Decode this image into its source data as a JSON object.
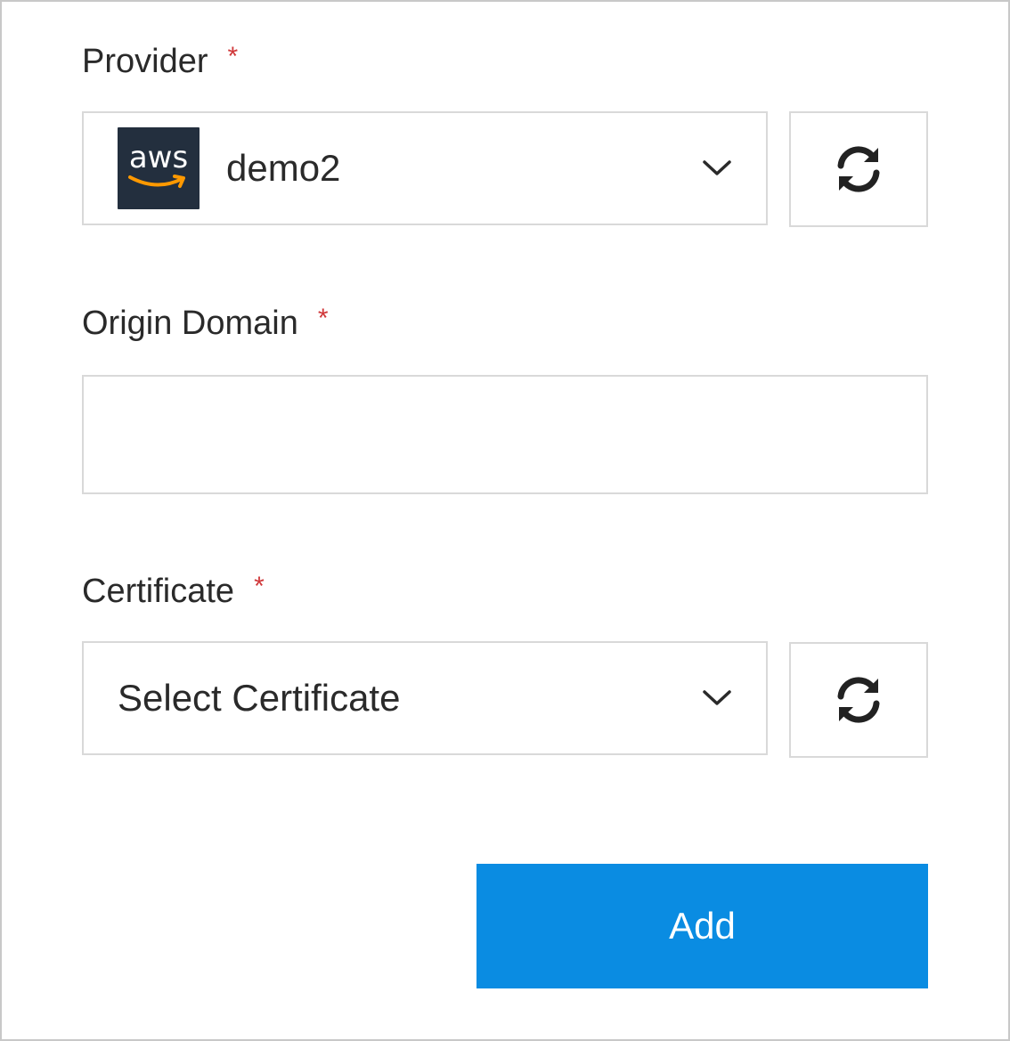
{
  "provider": {
    "label": "Provider",
    "required_mark": "*",
    "selected_value": "demo2",
    "logo_text": "aws"
  },
  "origin_domain": {
    "label": "Origin Domain",
    "required_mark": "*",
    "value": "",
    "placeholder": ""
  },
  "certificate": {
    "label": "Certificate",
    "required_mark": "*",
    "selected_value": "Select Certificate"
  },
  "actions": {
    "add_label": "Add"
  },
  "colors": {
    "required": "#d0383a",
    "primary_button": "#0a8ce2",
    "aws_logo_bg": "#232f3e",
    "aws_smile": "#ff9900",
    "border": "#d9d9d9"
  },
  "icons": {
    "provider_logo": "aws-logo-icon",
    "dropdown": "chevron-down-icon",
    "refresh": "refresh-icon"
  }
}
